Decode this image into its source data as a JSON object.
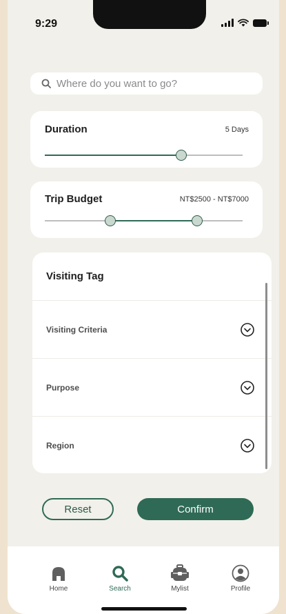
{
  "status": {
    "time": "9:29"
  },
  "search": {
    "placeholder": "Where do you want to go?",
    "value": ""
  },
  "duration": {
    "title": "Duration",
    "value_label": "5 Days",
    "level": 0.69
  },
  "budget": {
    "title": "Trip Budget",
    "value_label": "NT$2500 - NT$7000",
    "low": 0.33,
    "high": 0.77
  },
  "visiting_tag": {
    "title": "Visiting Tag",
    "rows": [
      {
        "label": "Visiting Criteria"
      },
      {
        "label": "Purpose"
      },
      {
        "label": "Region"
      }
    ]
  },
  "actions": {
    "reset_label": "Reset",
    "confirm_label": "Confirm"
  },
  "tabs": [
    {
      "label": "Home",
      "icon": "home-icon"
    },
    {
      "label": "Search",
      "icon": "search-icon",
      "active": true
    },
    {
      "label": "Mylist",
      "icon": "backpack-icon"
    },
    {
      "label": "Profile",
      "icon": "profile-icon"
    }
  ],
  "colors": {
    "accent": "#2f6a56",
    "background": "#f1f0ea",
    "page": "#efe3cf"
  }
}
